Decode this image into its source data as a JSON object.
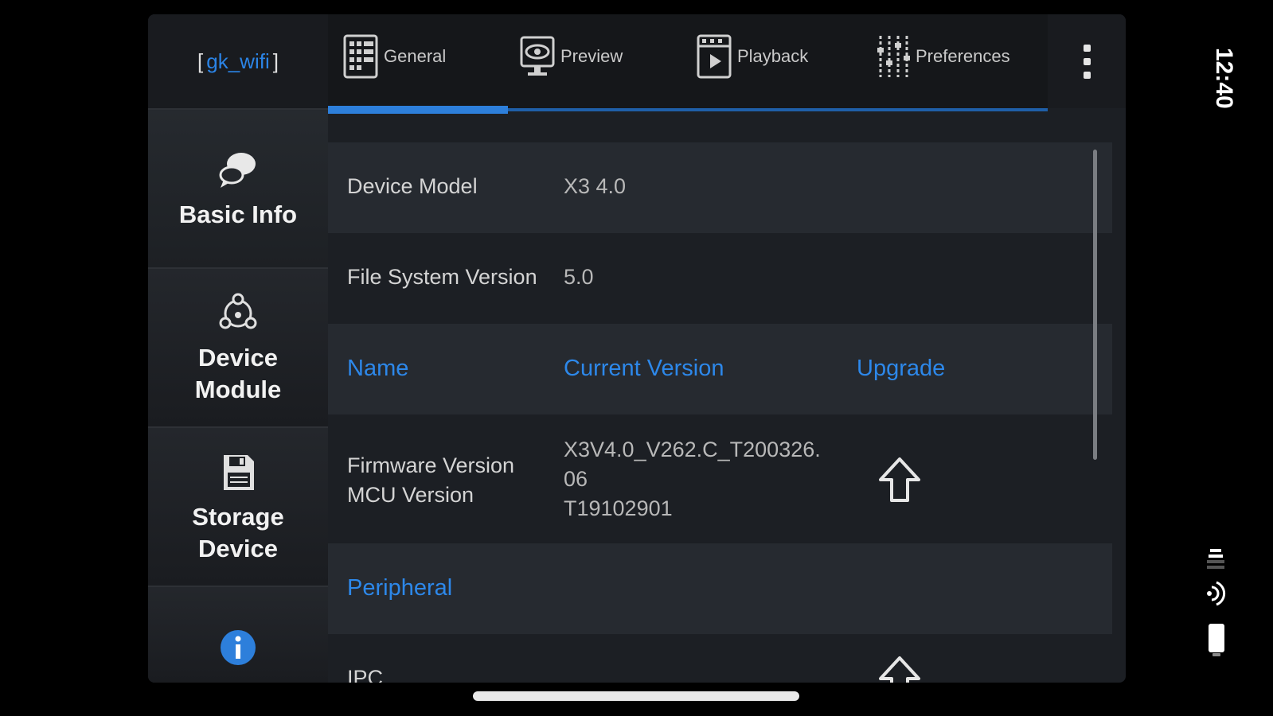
{
  "header": {
    "wifi_open": "[",
    "wifi_name": "gk_wifi",
    "wifi_close": "]"
  },
  "tabs": [
    {
      "label": "General",
      "icon": "general-grid-icon"
    },
    {
      "label": "Preview",
      "icon": "preview-eye-icon"
    },
    {
      "label": "Playback",
      "icon": "playback-film-icon"
    },
    {
      "label": "Preferences",
      "icon": "preferences-sliders-icon"
    }
  ],
  "sidebar": {
    "items": [
      {
        "label": "Basic Info",
        "icon": "chat-bubbles-icon"
      },
      {
        "label": "Device Module",
        "icon": "module-network-icon"
      },
      {
        "label": "Storage Device",
        "icon": "floppy-disk-icon"
      },
      {
        "label": "",
        "icon": "info-icon"
      }
    ]
  },
  "main": {
    "device_model_label": "Device Model",
    "device_model_value": "X3 4.0",
    "fs_version_label": "File System Version",
    "fs_version_value": "5.0",
    "col_name": "Name",
    "col_current": "Current Version",
    "col_upgrade": "Upgrade",
    "fw_label": "Firmware Version",
    "mcu_label": "MCU Version",
    "fw_value_line1": "X3V4.0_V262.C_T200326.",
    "fw_value_line2": "06",
    "mcu_value": "T19102901",
    "peripheral": "Peripheral",
    "ipc": "IPC"
  },
  "status": {
    "time": "12:40"
  },
  "colors": {
    "accent": "#2d88ea",
    "background": "#1c1f24"
  }
}
